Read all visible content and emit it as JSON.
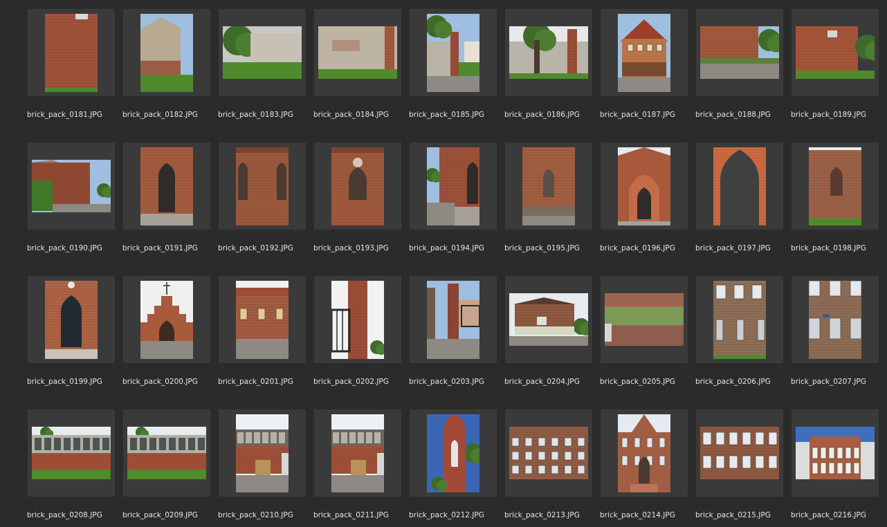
{
  "view": "thumbnail-grid",
  "files": [
    {
      "name": "brick_pack_0181.JPG",
      "orientation": "portrait",
      "scene": "brick-wall-window"
    },
    {
      "name": "brick_pack_0182.JPG",
      "orientation": "portrait",
      "scene": "plaster-house-grass"
    },
    {
      "name": "brick_pack_0183.JPG",
      "orientation": "landscape",
      "scene": "wall-trees-lawn"
    },
    {
      "name": "brick_pack_0184.JPG",
      "orientation": "landscape",
      "scene": "plaster-wall-lawn"
    },
    {
      "name": "brick_pack_0185.JPG",
      "orientation": "portrait",
      "scene": "gate-pillar-wall"
    },
    {
      "name": "brick_pack_0186.JPG",
      "orientation": "landscape",
      "scene": "wall-tree-pillar"
    },
    {
      "name": "brick_pack_0187.JPG",
      "orientation": "portrait",
      "scene": "wooden-house-porch"
    },
    {
      "name": "brick_pack_0188.JPG",
      "orientation": "landscape",
      "scene": "brick-house-courtyard"
    },
    {
      "name": "brick_pack_0189.JPG",
      "orientation": "landscape",
      "scene": "brick-house-trees"
    },
    {
      "name": "brick_pack_0190.JPG",
      "orientation": "landscape",
      "scene": "church-hedge"
    },
    {
      "name": "brick_pack_0191.JPG",
      "orientation": "portrait",
      "scene": "church-door-steps"
    },
    {
      "name": "brick_pack_0192.JPG",
      "orientation": "portrait",
      "scene": "gothic-windows-pair"
    },
    {
      "name": "brick_pack_0193.JPG",
      "orientation": "portrait",
      "scene": "gothic-window-rose"
    },
    {
      "name": "brick_pack_0194.JPG",
      "orientation": "portrait",
      "scene": "church-side-steps"
    },
    {
      "name": "brick_pack_0195.JPG",
      "orientation": "portrait",
      "scene": "gothic-window-wall"
    },
    {
      "name": "brick_pack_0196.JPG",
      "orientation": "portrait",
      "scene": "church-portal"
    },
    {
      "name": "brick_pack_0197.JPG",
      "orientation": "portrait",
      "scene": "big-arched-door"
    },
    {
      "name": "brick_pack_0198.JPG",
      "orientation": "portrait",
      "scene": "gothic-window-grass"
    },
    {
      "name": "brick_pack_0199.JPG",
      "orientation": "portrait",
      "scene": "arched-door-clock"
    },
    {
      "name": "brick_pack_0200.JPG",
      "orientation": "portrait",
      "scene": "stepped-gable-chapel"
    },
    {
      "name": "brick_pack_0201.JPG",
      "orientation": "portrait",
      "scene": "red-roof-house"
    },
    {
      "name": "brick_pack_0202.JPG",
      "orientation": "portrait",
      "scene": "gate-tower-pillar"
    },
    {
      "name": "brick_pack_0203.JPG",
      "orientation": "portrait",
      "scene": "gate-pillar-street"
    },
    {
      "name": "brick_pack_0204.JPG",
      "orientation": "landscape",
      "scene": "small-house-street"
    },
    {
      "name": "brick_pack_0205.JPG",
      "orientation": "landscape",
      "scene": "mossy-wall"
    },
    {
      "name": "brick_pack_0206.JPG",
      "orientation": "portrait",
      "scene": "facade-windows"
    },
    {
      "name": "brick_pack_0207.JPG",
      "orientation": "portrait",
      "scene": "facade-windows-sign"
    },
    {
      "name": "brick_pack_0208.JPG",
      "orientation": "landscape",
      "scene": "long-brick-building"
    },
    {
      "name": "brick_pack_0209.JPG",
      "orientation": "landscape",
      "scene": "long-brick-building"
    },
    {
      "name": "brick_pack_0210.JPG",
      "orientation": "portrait",
      "scene": "warehouse-pallets"
    },
    {
      "name": "brick_pack_0211.JPG",
      "orientation": "portrait",
      "scene": "warehouse-pallets"
    },
    {
      "name": "brick_pack_0212.JPG",
      "orientation": "portrait",
      "scene": "church-tower-sky"
    },
    {
      "name": "brick_pack_0213.JPG",
      "orientation": "landscape",
      "scene": "tenement-facade"
    },
    {
      "name": "brick_pack_0214.JPG",
      "orientation": "portrait",
      "scene": "gabled-building-door"
    },
    {
      "name": "brick_pack_0215.JPG",
      "orientation": "landscape",
      "scene": "tenement-windows"
    },
    {
      "name": "brick_pack_0216.JPG",
      "orientation": "landscape",
      "scene": "ornate-tenement-sky"
    }
  ]
}
